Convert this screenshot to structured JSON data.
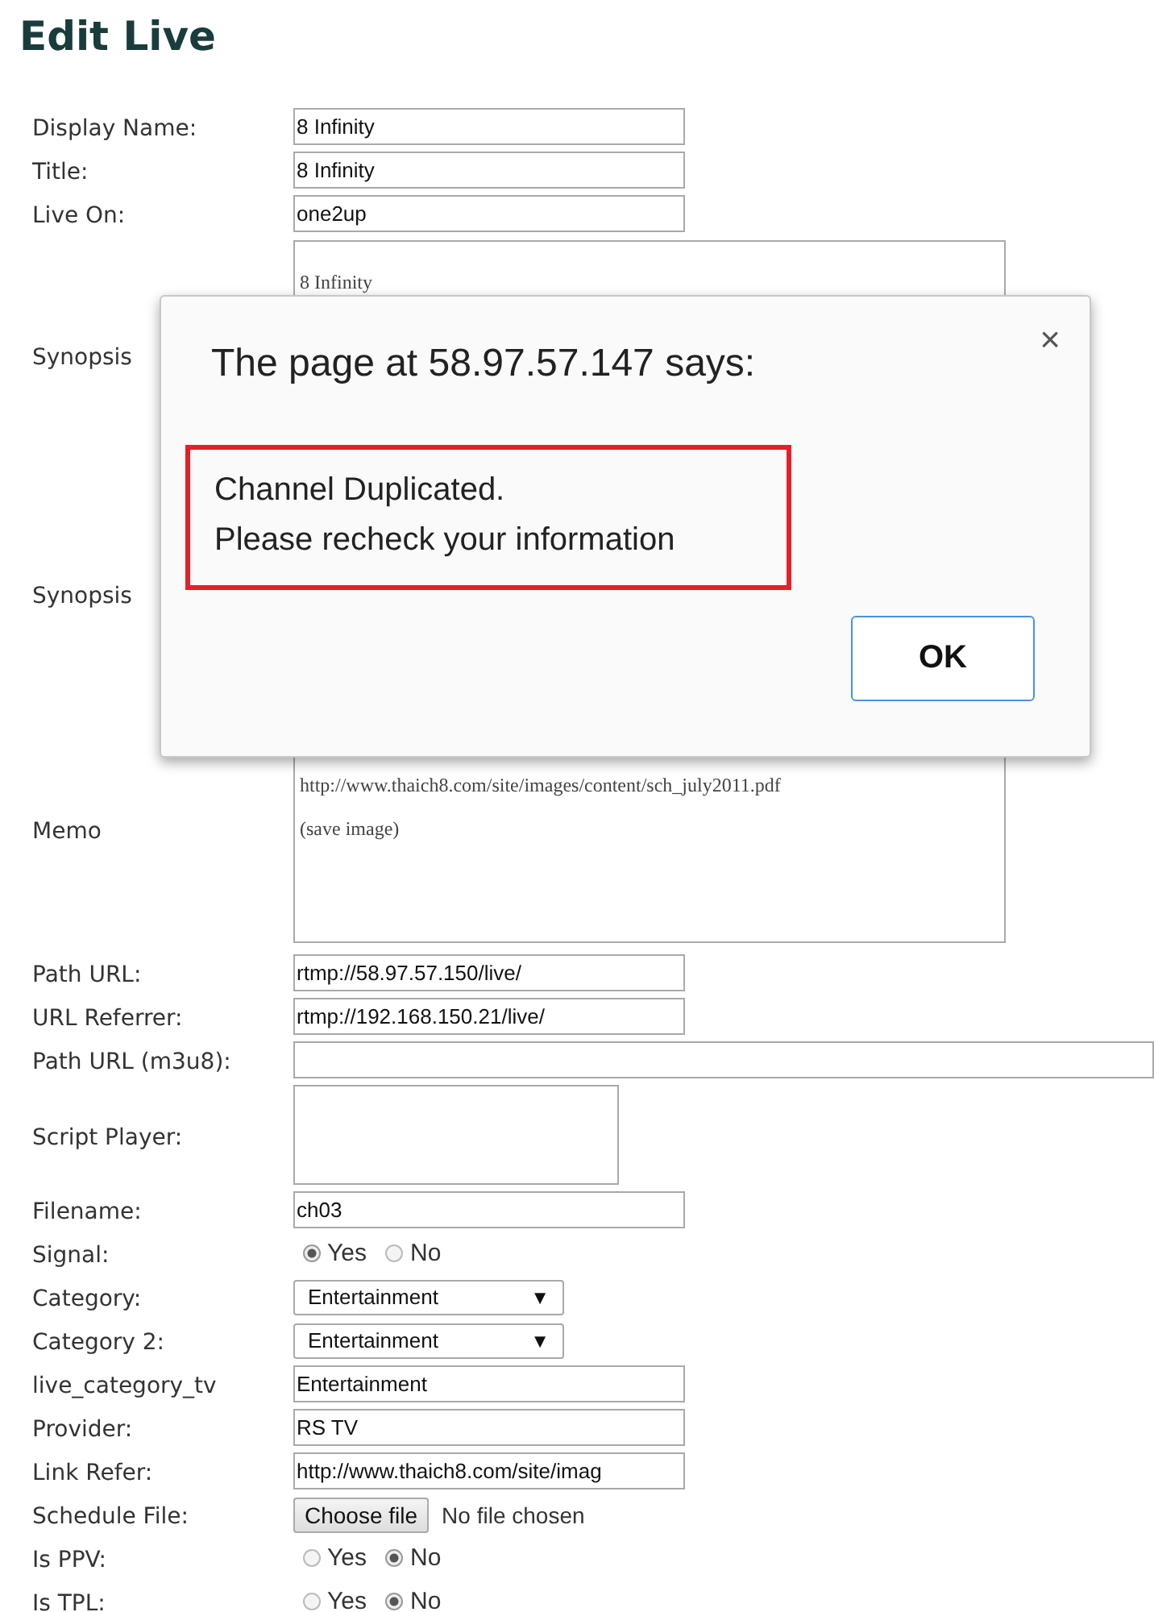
{
  "heading": "Edit Live",
  "rows": [
    {
      "kind": "text",
      "label": "Display Name:",
      "value": "8 Infinity"
    },
    {
      "kind": "text",
      "label": "Title:",
      "value": "8 Infinity"
    },
    {
      "kind": "text",
      "label": "Live On:",
      "value": "one2up"
    },
    {
      "kind": "textarea",
      "label": "Synopsis",
      "lines": [
        "8 Infinity"
      ]
    },
    {
      "kind": "textarea",
      "label": "Synopsis"
    },
    {
      "kind": "memo",
      "label": "Memo",
      "lines": [
        "http://www.thaich8.com/site/images/content/sch_july2011.pdf",
        "(save image)"
      ]
    },
    {
      "kind": "text",
      "label": "Path URL:",
      "value": "rtmp://58.97.57.150/live/"
    },
    {
      "kind": "text",
      "label": "URL Referrer:",
      "value": "rtmp://192.168.150.21/live/"
    },
    {
      "kind": "wide",
      "label": "Path URL (m3u8):"
    },
    {
      "kind": "script",
      "label": "Script Player:"
    },
    {
      "kind": "text",
      "label": "Filename:",
      "value": "ch03"
    },
    {
      "kind": "radio",
      "label": "Signal:",
      "options": [
        {
          "label": "Yes",
          "selected": true
        },
        {
          "label": "No",
          "selected": false
        }
      ]
    },
    {
      "kind": "select",
      "label": "Category:",
      "value": "Entertainment",
      "arrow": "▼"
    },
    {
      "kind": "select",
      "label": "Category 2:",
      "value": "Entertainment",
      "arrow": "▼"
    },
    {
      "kind": "text",
      "label": "live_category_tv",
      "value": "Entertainment"
    },
    {
      "kind": "text",
      "label": "Provider:",
      "value": "RS TV"
    },
    {
      "kind": "text",
      "label": "Link Refer:",
      "value": "http://www.thaich8.com/site/imag"
    },
    {
      "kind": "file",
      "label": "Schedule File:",
      "button": "Choose file",
      "status": "No file chosen"
    },
    {
      "kind": "radio",
      "label": "Is PPV:",
      "options": [
        {
          "label": "Yes",
          "selected": false
        },
        {
          "label": "No",
          "selected": true
        }
      ]
    },
    {
      "kind": "radio",
      "label": "Is TPL:",
      "options": [
        {
          "label": "Yes",
          "selected": false
        },
        {
          "label": "No",
          "selected": true
        }
      ]
    }
  ],
  "dialog": {
    "title": "The page at 58.97.57.147 says:",
    "close": "×",
    "message": [
      "Channel Duplicated.",
      "Please recheck your information"
    ],
    "button": "OK"
  }
}
